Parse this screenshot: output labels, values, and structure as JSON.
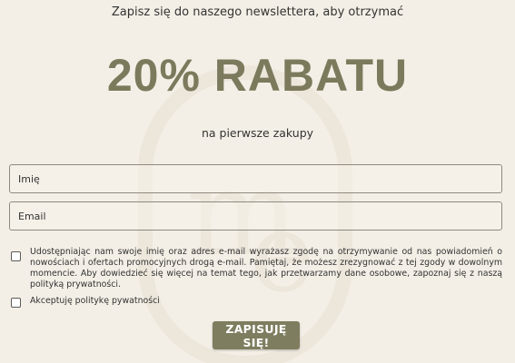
{
  "header": {
    "headline": "Zapisz się do naszego newslettera, aby otrzymać"
  },
  "promo": {
    "title": "20% RABATU",
    "subtitle": "na pierwsze zakupy"
  },
  "form": {
    "name_placeholder": "Imię",
    "email_placeholder": "Email",
    "consent_text": "Udostępniając nam swoje imię oraz adres e-mail wyrażasz zgodę na otrzymywanie od nas powiadomień o nowościach i ofertach promocyjnych drogą e-mail. Pamiętaj, że możesz zrezygnować z tej zgody w dowolnym momencie. Aby dowiedzieć się więcej na temat tego, jak przetwarzamy dane osobowe, zapoznaj się z naszą polityką prywatności.",
    "privacy_label": "Akceptuję politykę pywatności",
    "submit_label": "ZAPISUJĘ SIĘ!"
  },
  "watermark": {
    "icon": "me-logo-watermark",
    "letters": "me"
  },
  "colors": {
    "background": "#f4efe6",
    "accent": "#7e7d5f",
    "promo_text": "#7c7a5c"
  }
}
